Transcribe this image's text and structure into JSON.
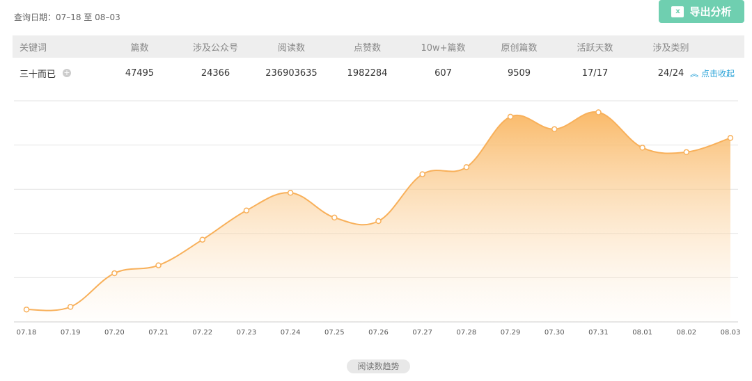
{
  "query_date": "查询日期：07–18 至 08–03",
  "export_button": {
    "icon": "excel-icon",
    "icon_text": "x",
    "label": "导出分析"
  },
  "table": {
    "headers": [
      "关键词",
      "篇数",
      "涉及公众号",
      "阅读数",
      "点赞数",
      "10w+篇数",
      "原创篇数",
      "活跃天数",
      "涉及类别"
    ],
    "row": [
      "三十而已",
      "47495",
      "24366",
      "236903635",
      "1982284",
      "607",
      "9509",
      "17/17",
      "24/24"
    ],
    "add_icon": "plus-circle-icon",
    "collapse_label": "点击收起",
    "collapse_icon": "chevron-double-up-icon"
  },
  "chart_data": {
    "type": "area",
    "title": "",
    "xlabel": "",
    "ylabel": "",
    "categories": [
      "07.18",
      "07.19",
      "07.20",
      "07.21",
      "07.22",
      "07.23",
      "07.24",
      "07.25",
      "07.26",
      "07.27",
      "07.28",
      "07.29",
      "07.30",
      "07.31",
      "08.01",
      "08.02",
      "08.03"
    ],
    "series": [
      {
        "name": "阅读数趋势",
        "values": [
          1400000,
          1700000,
          5500000,
          6400000,
          9300000,
          12600000,
          14600000,
          11800000,
          11400000,
          16700000,
          17500000,
          23200000,
          21800000,
          23700000,
          19700000,
          19200000,
          20800000
        ]
      }
    ],
    "ylim": [
      0,
      25000000
    ],
    "yticks": [
      0,
      5000000,
      10000000,
      15000000,
      20000000,
      25000000
    ],
    "grid": true,
    "legend": "bottom-center",
    "color": "#f8b05a"
  }
}
